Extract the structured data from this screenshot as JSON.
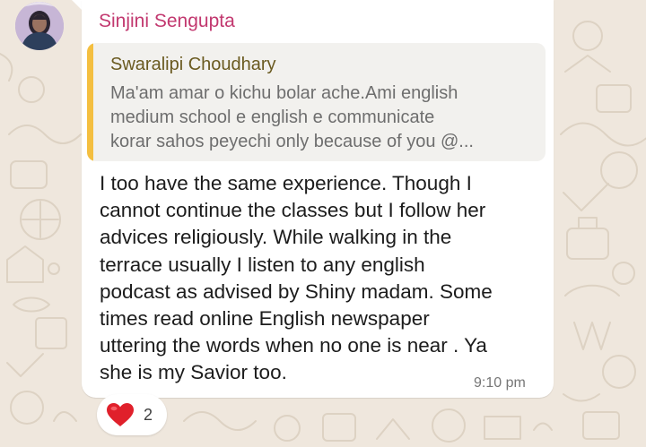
{
  "message": {
    "sender_name": "Sinjini Sengupta",
    "quoted_reply": {
      "author": "Swaralipi Choudhary",
      "text": "Ma'am amar o kichu bolar ache.Ami english\nmedium school e english e communicate\nkorar sahos peyechi only because of you  @..."
    },
    "body": "I too have the same experience. Though I\ncannot continue the classes but I follow her\nadvices religiously. While walking in the\nterrace usually I listen to any english\npodcast as advised by Shiny madam. Some\ntimes read online English newspaper\nuttering the words when no one is near .  Ya\nshe is my Savior too.",
    "time": "9:10 pm"
  },
  "reactions": [
    {
      "icon": "red-heart-icon",
      "count": "2"
    }
  ],
  "colors": {
    "sender_name": "#c2386f",
    "quote_author": "#6a5a20",
    "quote_accent": "#f4bf40",
    "quote_background": "#f2f1ee",
    "chat_wallpaper": "#efe7dd",
    "heart": "#e0202b"
  }
}
